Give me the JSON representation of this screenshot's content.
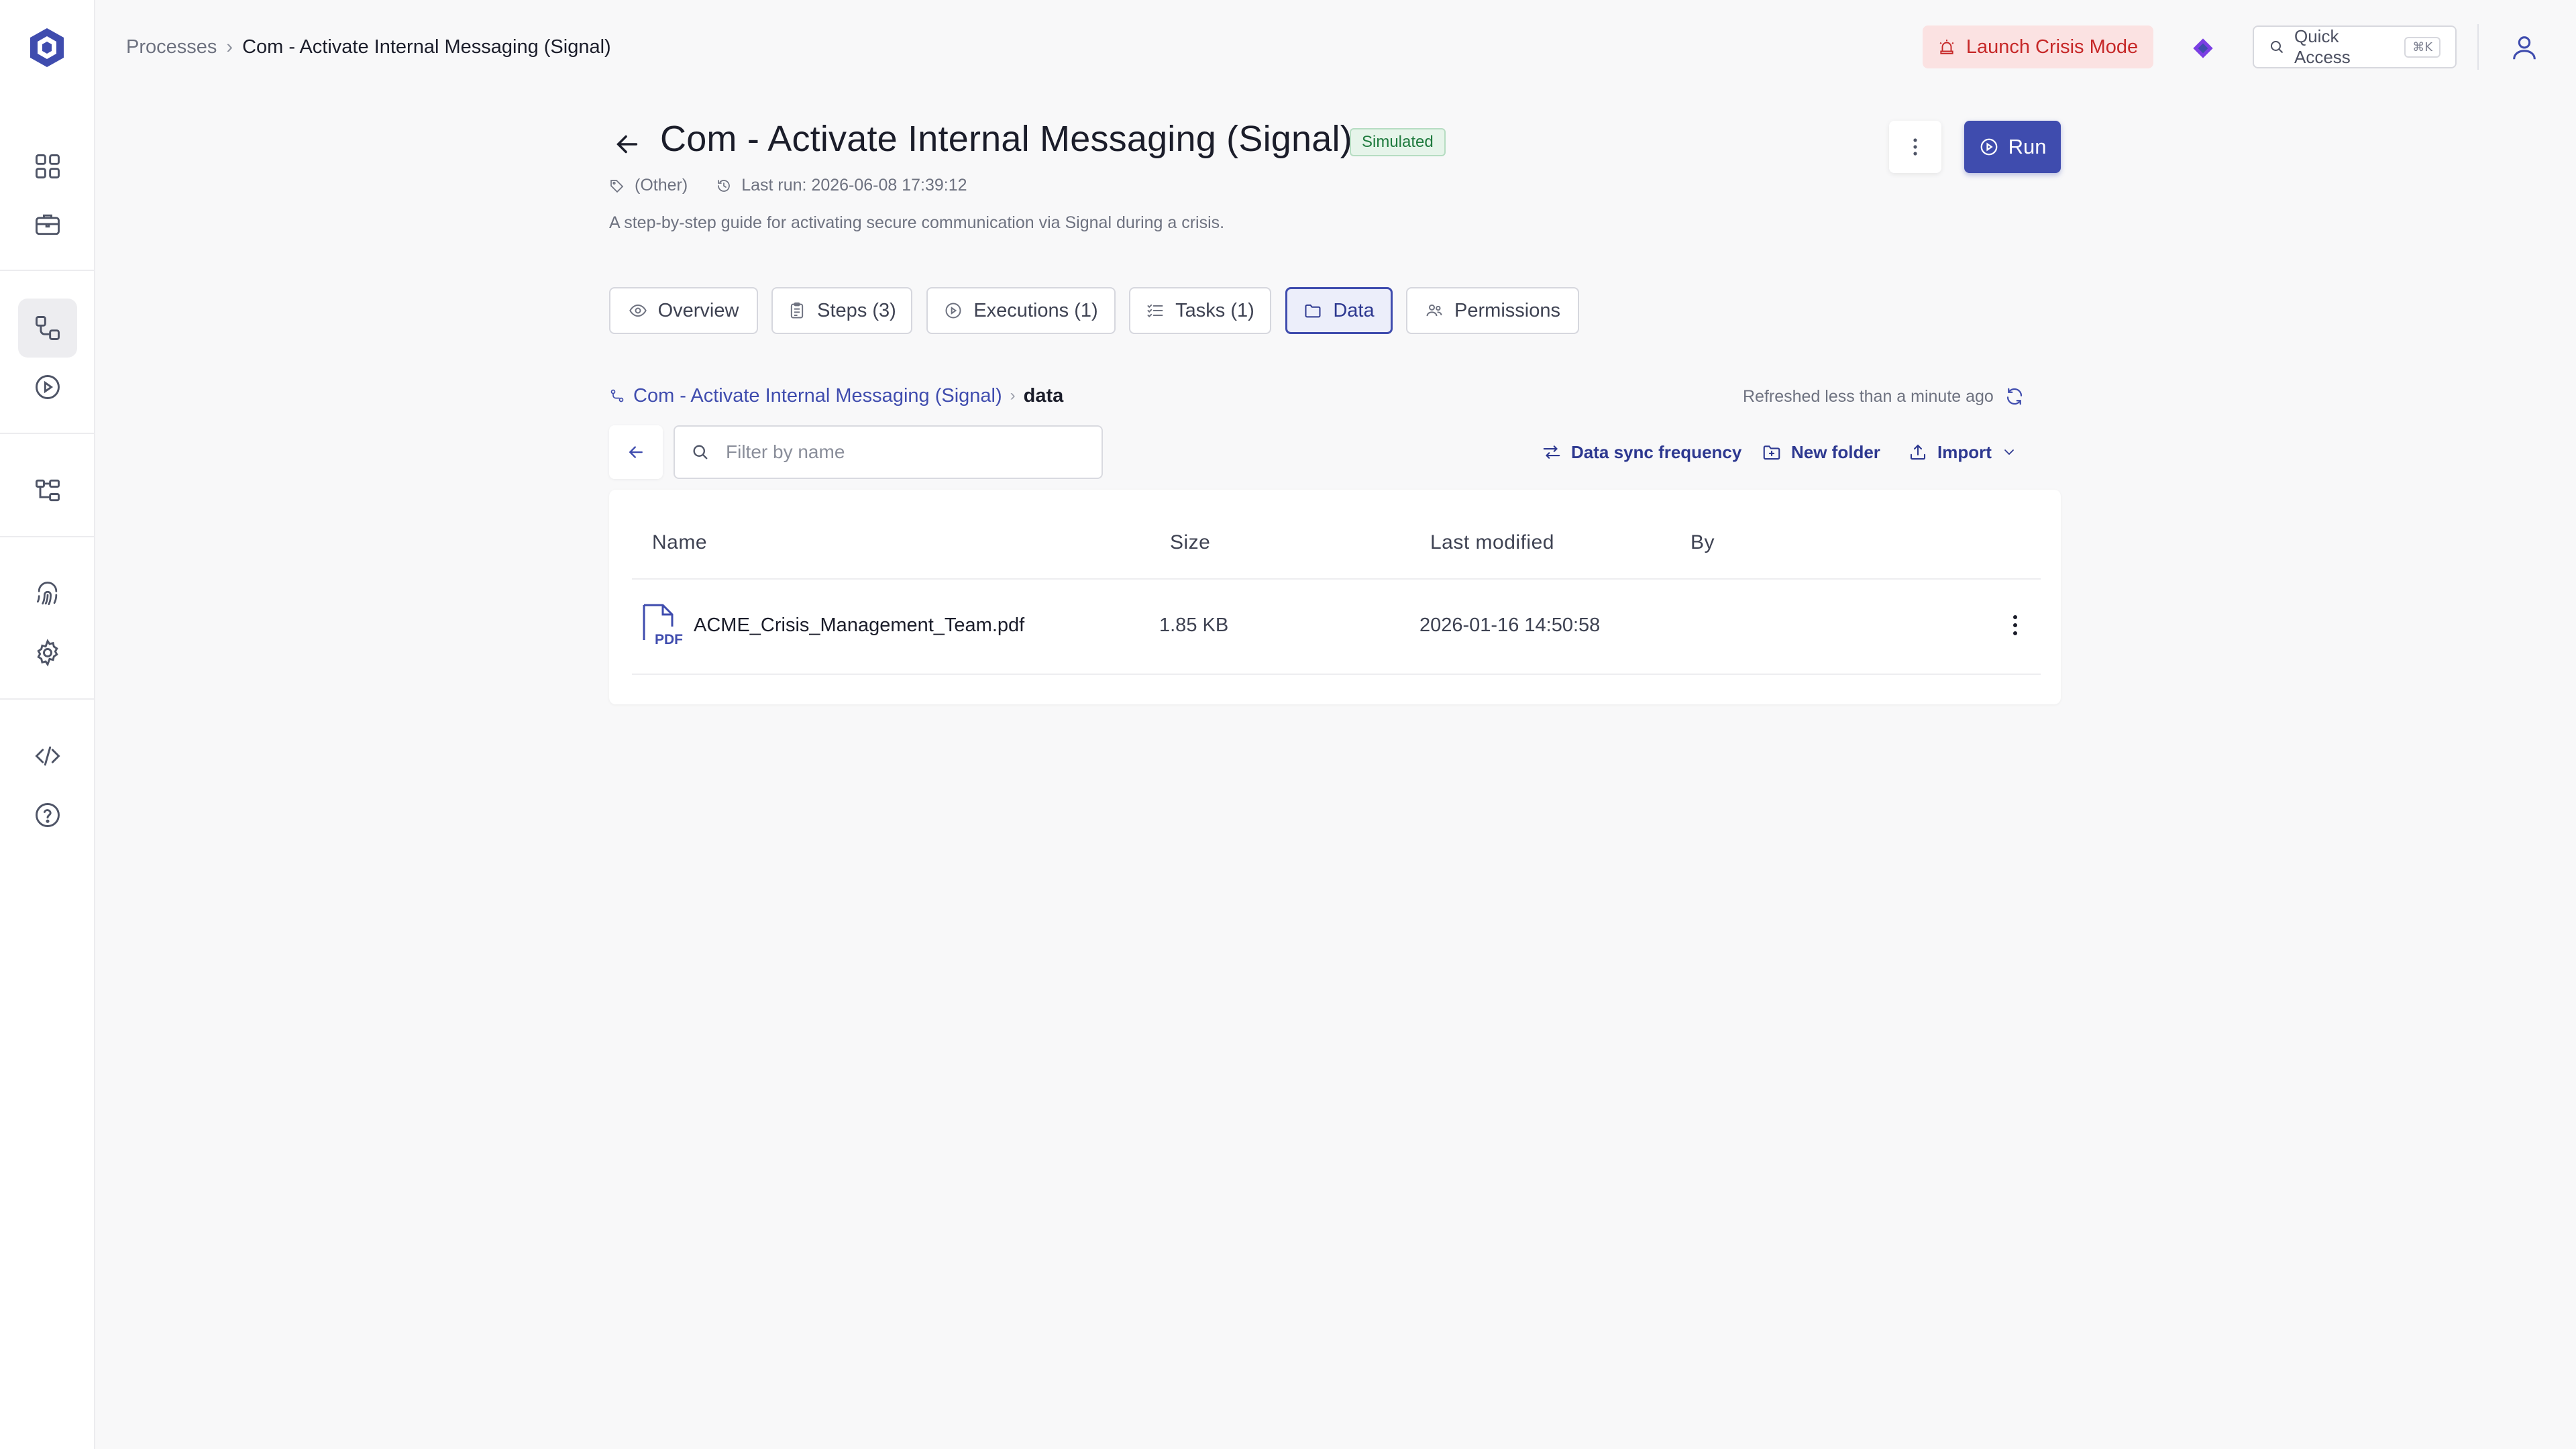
{
  "breadcrumb": {
    "root": "Processes",
    "current": "Com - Activate Internal Messaging (Signal)"
  },
  "topbar": {
    "crisis_label": "Launch Crisis Mode",
    "quick_access_label": "Quick Access",
    "quick_access_shortcut": "⌘K"
  },
  "header": {
    "title": "Com - Activate Internal Messaging (Signal)",
    "badge": "Simulated",
    "tag": "(Other)",
    "last_run": "Last run: 2026-06-08 17:39:12",
    "description": "A step-by-step guide for activating secure communication via Signal during a crisis.",
    "run_label": "Run"
  },
  "tabs": [
    {
      "label": "Overview",
      "icon": "eye-icon"
    },
    {
      "label": "Steps (3)",
      "icon": "clipboard-icon"
    },
    {
      "label": "Executions (1)",
      "icon": "play-circle-icon"
    },
    {
      "label": "Tasks (1)",
      "icon": "checklist-icon"
    },
    {
      "label": "Data",
      "icon": "folder-icon",
      "active": true
    },
    {
      "label": "Permissions",
      "icon": "users-icon"
    }
  ],
  "data_view": {
    "path_root": "Com - Activate Internal Messaging (Signal)",
    "path_current": "data",
    "refreshed": "Refreshed less than a minute ago",
    "filter_placeholder": "Filter by name",
    "actions": {
      "sync": "Data sync frequency",
      "new_folder": "New folder",
      "import": "Import"
    },
    "columns": {
      "name": "Name",
      "size": "Size",
      "modified": "Last modified",
      "by": "By"
    },
    "files": [
      {
        "name": "ACME_Crisis_Management_Team.pdf",
        "size": "1.85 KB",
        "modified": "2026-01-16 14:50:58",
        "by": "",
        "type_label": "PDF"
      }
    ]
  },
  "colors": {
    "accent": "#3f4cae",
    "crisis_bg": "#fbe2e2",
    "crisis_text": "#c62828",
    "badge_bg": "#e6f4ea",
    "badge_text": "#1f7a3e"
  }
}
